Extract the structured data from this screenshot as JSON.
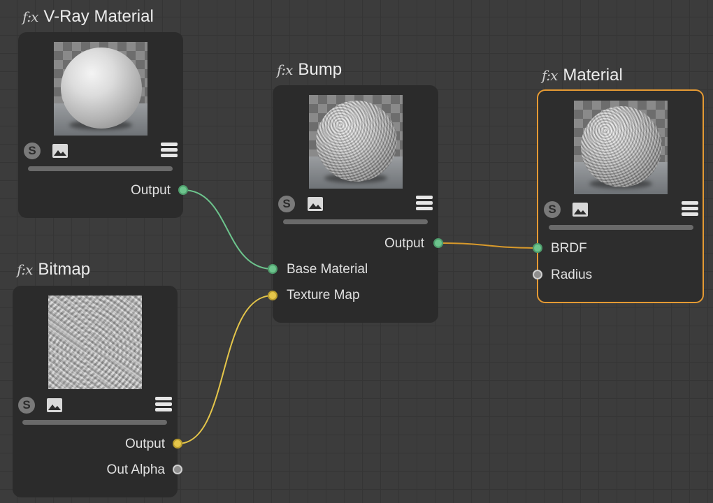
{
  "nodes": {
    "vray": {
      "fx": "f:x",
      "title": "V-Ray Material",
      "outputs": [
        "Output"
      ]
    },
    "bitmap": {
      "fx": "f:x",
      "title": "Bitmap",
      "outputs": [
        "Output",
        "Out Alpha"
      ]
    },
    "bump": {
      "fx": "f:x",
      "title": "Bump",
      "outputs": [
        "Output"
      ],
      "inputs": [
        "Base Material",
        "Texture Map"
      ]
    },
    "material": {
      "fx": "f:x",
      "title": "Material",
      "inputs": [
        "BRDF",
        "Radius"
      ],
      "selected": true
    }
  },
  "toolbar_icons": [
    "s-icon",
    "image-icon",
    "menu-icon"
  ],
  "colors": {
    "wire_green": "#6dc48d",
    "wire_yellow": "#e5c64a",
    "wire_orange": "#d99a2b",
    "selection": "#e59a33"
  }
}
